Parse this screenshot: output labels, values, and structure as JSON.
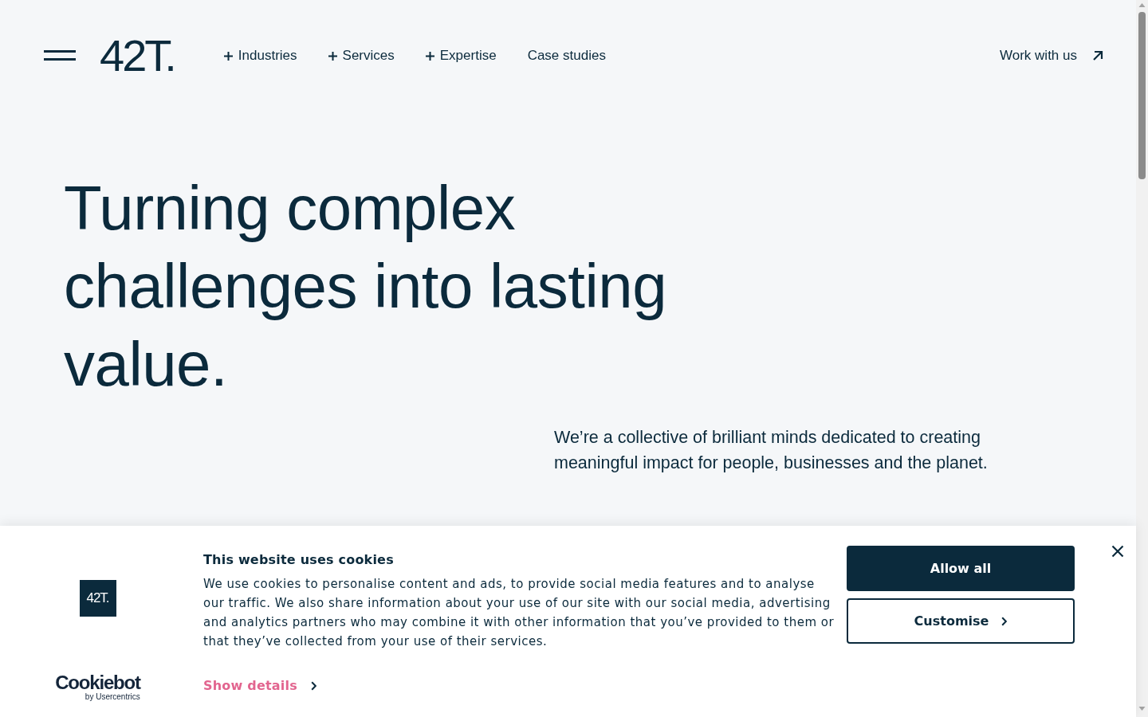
{
  "header": {
    "logo": "42T.",
    "nav": [
      {
        "label": "Industries",
        "expandable": true
      },
      {
        "label": "Services",
        "expandable": true
      },
      {
        "label": "Expertise",
        "expandable": true
      },
      {
        "label": "Case studies",
        "expandable": false
      }
    ],
    "cta": "Work with us"
  },
  "hero": {
    "heading": "Turning complex challenges into lasting value.",
    "intro": "We’re a collective of brilliant minds dedicated to creating meaningful impact for people, businesses and the planet."
  },
  "cookie_banner": {
    "logo": "42T.",
    "title": "This website uses cookies",
    "body": "We use cookies to personalise content and ads, to provide social media features and to analyse our traffic. We also share information about your use of our site with our social media, advertising and analytics partners who may combine it with other information that you’ve provided to them or that they’ve collected from your use of their services.",
    "show_details": "Show details",
    "buttons": [
      {
        "label": "Allow all",
        "kind": "primary"
      },
      {
        "label": "Customise",
        "kind": "outline"
      }
    ],
    "provider": {
      "name": "Cookiebot",
      "tagline": "by Usercentrics"
    }
  }
}
